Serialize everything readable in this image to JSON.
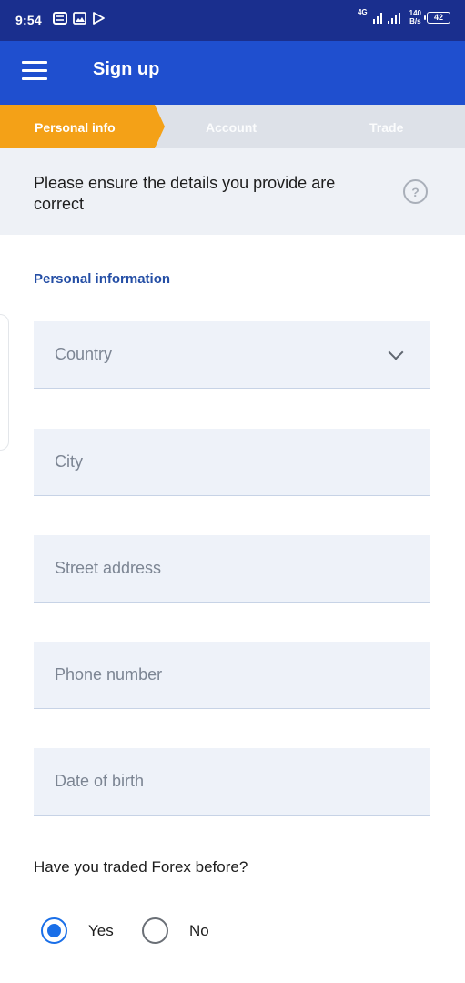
{
  "status_bar": {
    "time": "9:54",
    "network": "4G",
    "speed_value": "140",
    "speed_unit": "B/s",
    "battery": "42"
  },
  "app_bar": {
    "title": "Sign up"
  },
  "stepper": {
    "steps": [
      {
        "label": "Personal info",
        "active": true
      },
      {
        "label": "Account",
        "active": false
      },
      {
        "label": "Trade",
        "active": false
      }
    ],
    "active_color": "#f4a117"
  },
  "notice": {
    "text": "Please ensure the details you provide are correct",
    "help_symbol": "?"
  },
  "form": {
    "section_title": "Personal information",
    "fields": [
      {
        "placeholder": "Country",
        "type": "select"
      },
      {
        "placeholder": "City",
        "type": "text"
      },
      {
        "placeholder": "Street address",
        "type": "text"
      },
      {
        "placeholder": "Phone number",
        "type": "text"
      },
      {
        "placeholder": "Date of birth",
        "type": "text"
      }
    ],
    "question": "Have you traded Forex before?",
    "options": [
      {
        "label": "Yes",
        "checked": true
      },
      {
        "label": "No",
        "checked": false
      }
    ]
  },
  "colors": {
    "status_bar": "#1a2f8e",
    "app_bar": "#1f4fcf",
    "accent": "#1a6fe8"
  }
}
